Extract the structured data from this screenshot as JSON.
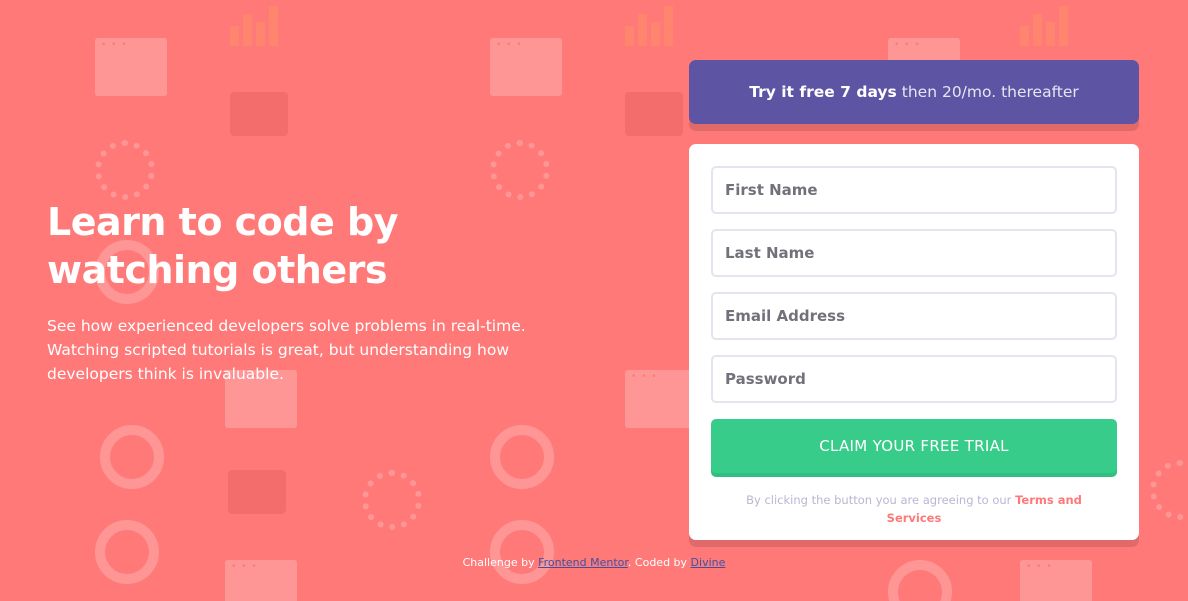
{
  "hero": {
    "headline": "Learn to code by watching others",
    "description": "See how experienced developers solve problems in real-time. Watching scripted tutorials is great, but understanding how developers think is invaluable."
  },
  "promo": {
    "strong": "Try it free 7 days",
    "rest": "then 20/mo. thereafter"
  },
  "form": {
    "first_name_placeholder": "First Name",
    "last_name_placeholder": "Last Name",
    "email_placeholder": "Email Address",
    "password_placeholder": "Password",
    "submit_label": "CLAIM YOUR FREE TRIAL",
    "terms_prefix": "By clicking the button you are agreeing to our",
    "terms_link": "Terms and Services"
  },
  "footer": {
    "challenge_prefix": "Challenge by",
    "challenge_link": "Frontend Mentor",
    "coded_prefix": "Coded by",
    "coded_link": "Divine"
  },
  "colors": {
    "background": "#ff7979",
    "promo": "#5e54a4",
    "button": "#38cc8b",
    "accent": "#ff7979"
  }
}
